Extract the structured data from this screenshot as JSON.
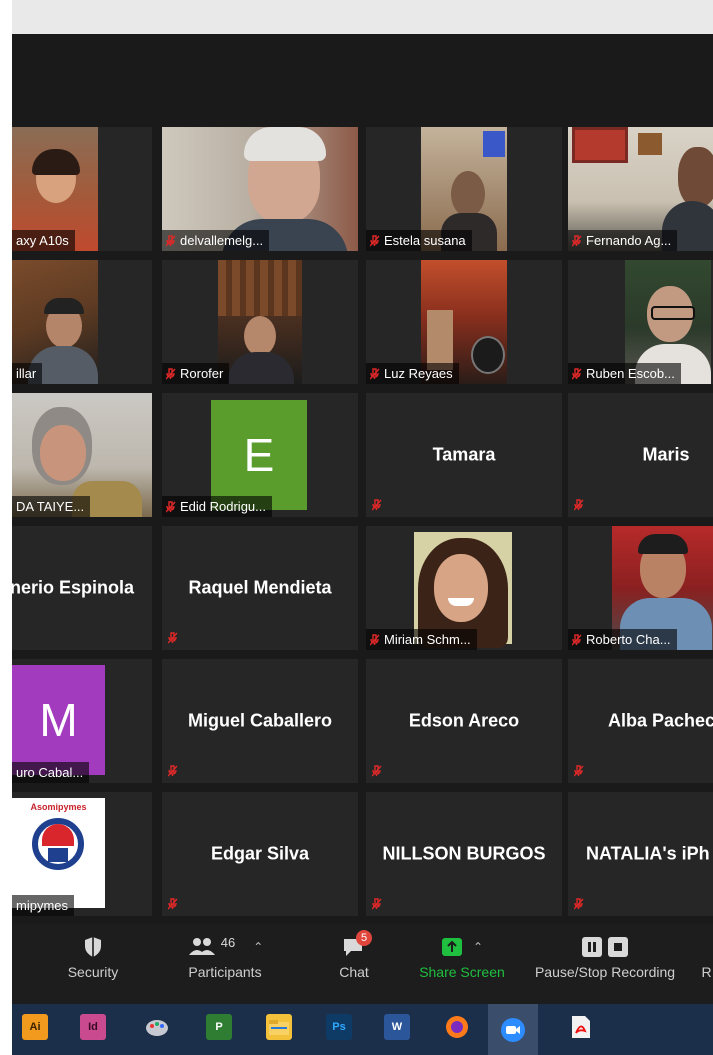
{
  "participants": {
    "row1": [
      {
        "name": "axy A10s",
        "muted": false
      },
      {
        "name": "delvallemelg...",
        "muted": true
      },
      {
        "name": "Estela susana",
        "muted": true
      },
      {
        "name": "Fernando Ag...",
        "muted": true
      }
    ],
    "row2": [
      {
        "name": "illar",
        "muted": false
      },
      {
        "name": "Rorofer",
        "muted": true
      },
      {
        "name": "Luz Reyaes",
        "muted": true
      },
      {
        "name": "Ruben Escob...",
        "muted": true
      }
    ],
    "row3": [
      {
        "name": "DA TAIYE...",
        "muted": false
      },
      {
        "name": "Edid Rodrigu...",
        "muted": true,
        "avatar_letter": "E"
      },
      {
        "name": "Tamara",
        "muted": true
      },
      {
        "name": "Maris",
        "muted": true
      }
    ],
    "row4": [
      {
        "name": "nerio Espinola",
        "muted": false
      },
      {
        "name": "Raquel Mendieta",
        "muted": true
      },
      {
        "name": "Miriam Schm...",
        "muted": true
      },
      {
        "name": "Roberto Cha...",
        "muted": true
      }
    ],
    "row5": [
      {
        "name": "uro Cabal...",
        "muted": false,
        "avatar_letter": "M"
      },
      {
        "name": "Miguel Caballero",
        "muted": true
      },
      {
        "name": "Edson Areco",
        "muted": true
      },
      {
        "name": "Alba Pacheco",
        "muted": true
      }
    ],
    "row6": [
      {
        "name": "mipymes",
        "muted": false,
        "logo_text": "Asomipymes"
      },
      {
        "name": "Edgar Silva",
        "muted": true
      },
      {
        "name": "NILLSON BURGOS",
        "muted": true
      },
      {
        "name": "NATALIA's iPh",
        "muted": true
      }
    ]
  },
  "toolbar": {
    "security_label": "Security",
    "participants_label": "Participants",
    "participants_count": "46",
    "chat_label": "Chat",
    "chat_badge": "5",
    "share_label": "Share Screen",
    "record_label": "Pause/Stop Recording",
    "cutoff_label": "R"
  },
  "taskbar": {
    "apps": [
      {
        "label": "Ai",
        "icon": "illustrator-icon"
      },
      {
        "label": "Id",
        "icon": "indesign-icon"
      },
      {
        "label": "",
        "icon": "paint-icon"
      },
      {
        "label": "P",
        "icon": "project-icon"
      },
      {
        "label": "",
        "icon": "file-explorer-icon"
      },
      {
        "label": "Ps",
        "icon": "photoshop-icon"
      },
      {
        "label": "W",
        "icon": "word-icon"
      },
      {
        "label": "",
        "icon": "firefox-icon"
      },
      {
        "label": "",
        "icon": "zoom-icon"
      },
      {
        "label": "",
        "icon": "acrobat-icon"
      }
    ]
  },
  "colors": {
    "mute_red": "#e02828",
    "share_green": "#1fbf3f",
    "avatar_green": "#5a9d2c",
    "avatar_purple": "#a33bbf",
    "chat_badge": "#e0463b"
  }
}
